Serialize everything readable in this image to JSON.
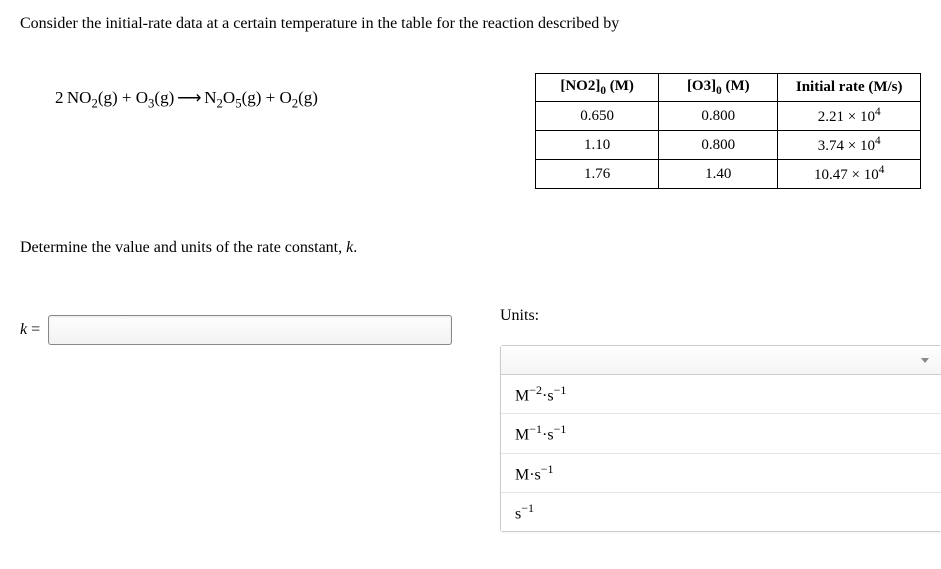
{
  "intro": "Consider the initial-rate data at a certain temperature in the table for the reaction described by",
  "equation": {
    "lhs1_coef": "2",
    "lhs1_species_base": "NO",
    "lhs1_species_sub": "2",
    "lhs1_phase": "(g)",
    "plus": " + ",
    "lhs2_species_base": "O",
    "lhs2_species_sub": "3",
    "lhs2_phase": "(g)",
    "arrow": " ⟶ ",
    "rhs1_species_base": "N",
    "rhs1_species_sub1": "2",
    "rhs1_species_mid": "O",
    "rhs1_species_sub2": "5",
    "rhs1_phase": "(g)",
    "rhs2_species_base": "O",
    "rhs2_species_sub": "2",
    "rhs2_phase": "(g)"
  },
  "table": {
    "headers": {
      "col1_pre": "[NO2]",
      "col1_sub": "0",
      "col1_post": " (M)",
      "col2_pre": "[O3]",
      "col2_sub": "0",
      "col2_post": " (M)",
      "col3": "Initial rate (M/s)"
    },
    "rows": [
      {
        "no2": "0.650",
        "o3": "0.800",
        "rate_m": "2.21 × 10",
        "rate_e": "4"
      },
      {
        "no2": "1.10",
        "o3": "0.800",
        "rate_m": "3.74 × 10",
        "rate_e": "4"
      },
      {
        "no2": "1.76",
        "o3": "1.40",
        "rate_m": "10.47 × 10",
        "rate_e": "4"
      }
    ]
  },
  "question": "Determine the value and units of the rate constant, ",
  "question_var": "k",
  "question_end": ".",
  "k_label_var": "k",
  "k_label_eq": " = ",
  "units_label": "Units:",
  "dropdown": {
    "selected": "",
    "options": [
      {
        "base": "M",
        "exp1": "−2",
        "mid": "·s",
        "exp2": "−1"
      },
      {
        "base": "M",
        "exp1": "−1",
        "mid": "·s",
        "exp2": "−1"
      },
      {
        "base": "M·s",
        "exp1": "−1",
        "mid": "",
        "exp2": ""
      },
      {
        "base": "s",
        "exp1": "−1",
        "mid": "",
        "exp2": ""
      }
    ]
  },
  "chart_data": {
    "type": "table",
    "columns": [
      "[NO2]0 (M)",
      "[O3]0 (M)",
      "Initial rate (M/s)"
    ],
    "rows": [
      [
        0.65,
        0.8,
        22100.0
      ],
      [
        1.1,
        0.8,
        37400.0
      ],
      [
        1.76,
        1.4,
        104700.0
      ]
    ]
  }
}
